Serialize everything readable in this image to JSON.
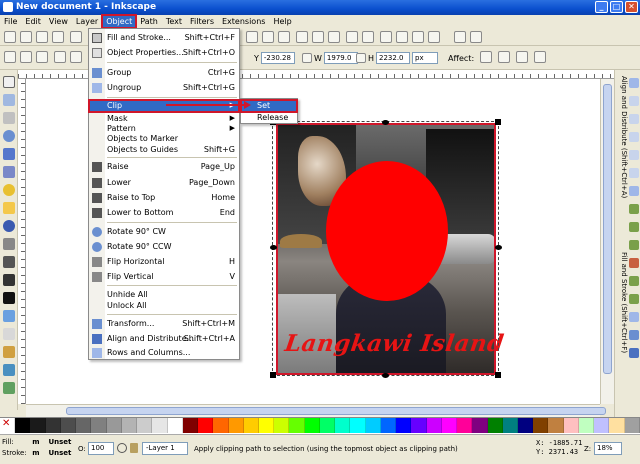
{
  "window": {
    "title": "New document 1 - Inkscape"
  },
  "menubar": [
    "File",
    "Edit",
    "View",
    "Layer",
    "Object",
    "Path",
    "Text",
    "Filters",
    "Extensions",
    "Help"
  ],
  "transform": {
    "x_label": "X",
    "y_label": "Y",
    "y_value": "-230.28",
    "w_label": "W",
    "w_value": "1979.0",
    "h_label": "H",
    "h_value": "2232.0",
    "unit": "px",
    "affect_label": "Affect:"
  },
  "object_menu": {
    "items": [
      {
        "label": "Fill and Stroke...",
        "shortcut": "Shift+Ctrl+F",
        "icon": "fill-stroke-icon"
      },
      {
        "label": "Object Properties...",
        "shortcut": "Shift+Ctrl+O",
        "icon": "properties-icon"
      },
      {
        "label": "Group",
        "shortcut": "Ctrl+G",
        "icon": "group-icon"
      },
      {
        "label": "Ungroup",
        "shortcut": "Shift+Ctrl+G",
        "icon": "ungroup-icon"
      },
      {
        "label": "Clip",
        "shortcut": "",
        "icon": "",
        "submenu": true
      },
      {
        "label": "Mask",
        "shortcut": "",
        "icon": "",
        "submenu": true
      },
      {
        "label": "Pattern",
        "shortcut": "",
        "icon": "",
        "submenu": true
      },
      {
        "label": "Objects to Marker",
        "shortcut": "",
        "icon": ""
      },
      {
        "label": "Objects to Guides",
        "shortcut": "Shift+G",
        "icon": ""
      },
      {
        "label": "Raise",
        "shortcut": "Page_Up",
        "icon": "raise-icon"
      },
      {
        "label": "Lower",
        "shortcut": "Page_Down",
        "icon": "lower-icon"
      },
      {
        "label": "Raise to Top",
        "shortcut": "Home",
        "icon": "raise-top-icon"
      },
      {
        "label": "Lower to Bottom",
        "shortcut": "End",
        "icon": "lower-bottom-icon"
      },
      {
        "label": "Rotate 90° CW",
        "shortcut": "",
        "icon": "rotate-cw-icon"
      },
      {
        "label": "Rotate 90° CCW",
        "shortcut": "",
        "icon": "rotate-ccw-icon"
      },
      {
        "label": "Flip Horizontal",
        "shortcut": "H",
        "icon": "flip-h-icon"
      },
      {
        "label": "Flip Vertical",
        "shortcut": "V",
        "icon": "flip-v-icon"
      },
      {
        "label": "Unhide All",
        "shortcut": "",
        "icon": ""
      },
      {
        "label": "Unlock All",
        "shortcut": "",
        "icon": ""
      },
      {
        "label": "Transform...",
        "shortcut": "Shift+Ctrl+M",
        "icon": "transform-icon"
      },
      {
        "label": "Align and Distribute...",
        "shortcut": "Shift+Ctrl+A",
        "icon": "align-icon"
      },
      {
        "label": "Rows and Columns...",
        "shortcut": "",
        "icon": "rows-columns-icon"
      }
    ]
  },
  "clip_submenu": [
    "Set",
    "Release"
  ],
  "canvas": {
    "photo_text": "Langkawi Island"
  },
  "dock": {
    "tab1": "Align and Distribute (Shift+Ctrl+A)",
    "tab2": "Fill and Stroke (Shift+Ctrl+F)"
  },
  "palette": [
    "#000000",
    "#1a1a1a",
    "#333333",
    "#4d4d4d",
    "#666666",
    "#808080",
    "#999999",
    "#b3b3b3",
    "#cccccc",
    "#e6e6e6",
    "#ffffff",
    "#800000",
    "#ff0000",
    "#ff6600",
    "#ff9900",
    "#ffcc00",
    "#ffff00",
    "#ccff00",
    "#66ff00",
    "#00ff00",
    "#00ff66",
    "#00ffcc",
    "#00ffff",
    "#00ccff",
    "#0066ff",
    "#0000ff",
    "#6600ff",
    "#cc00ff",
    "#ff00ff",
    "#ff0099",
    "#800080",
    "#008000",
    "#008080",
    "#000080",
    "#804000",
    "#c08040",
    "#ffc0c0",
    "#c0ffc0",
    "#c0c0ff",
    "#ffe0a0",
    "#a0a0a0"
  ],
  "status": {
    "fill_label": "Fill:",
    "fill_value": "m",
    "fill_state": "Unset",
    "stroke_label": "Stroke:",
    "stroke_value": "m",
    "stroke_state": "Unset",
    "opacity_label": "O:",
    "opacity_value": "100",
    "layer": "-Layer 1",
    "message": "Apply clipping path to selection (using the topmost object as clipping path)",
    "x_readout": "X: -1885.71",
    "y_readout": "Y:  2371.43",
    "zoom_label": "Z:",
    "zoom_value": "18%"
  }
}
